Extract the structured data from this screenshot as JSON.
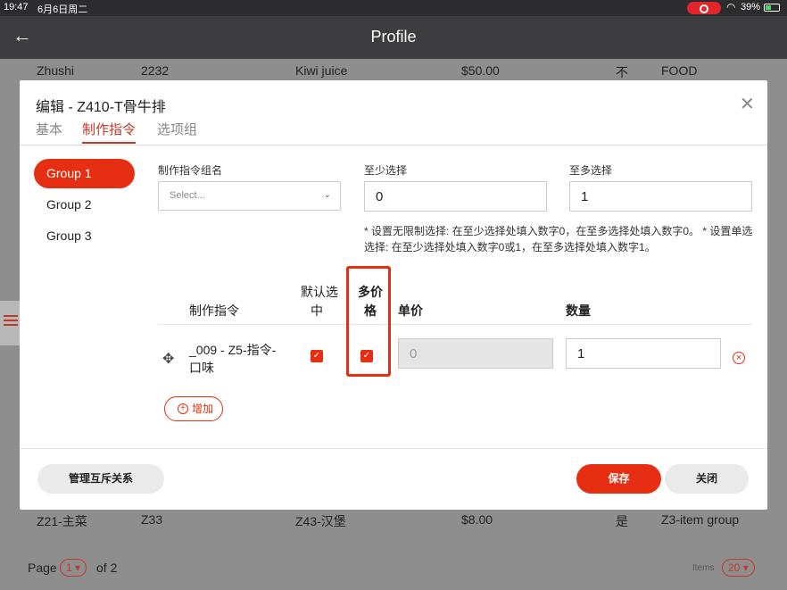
{
  "status_bar": {
    "time": "19:47",
    "date": "6月6日周二",
    "battery": "39%"
  },
  "header": {
    "back_icon": "arrow-left-icon",
    "title": "Profile"
  },
  "background_rows": [
    {
      "c1": "Zhushi",
      "c2": "2232",
      "c3": "Kiwi juice",
      "c4": "$50.00",
      "c5": "不",
      "c6": "FOOD"
    },
    {
      "c1": "Z21-主菜",
      "c2": "Z33",
      "c3": "Z43-汉堡",
      "c4": "$8.00",
      "c5": "是",
      "c6": "Z3-item group"
    }
  ],
  "pagination": {
    "page_label": "Page",
    "page_value": "1",
    "of_label": "of 2",
    "items_label": "Items",
    "items_value": "20"
  },
  "modal": {
    "title": "编辑 - Z410-T骨牛排",
    "tabs": [
      "基本",
      "制作指令",
      "选项组"
    ],
    "groups": [
      "Group 1",
      "Group 2",
      "Group 3"
    ],
    "fields": {
      "group_name_label": "制作指令组名",
      "select_placeholder": "Select...",
      "min_label": "至少选择",
      "min_value": "0",
      "max_label": "至多选择",
      "max_value": "1"
    },
    "note": "* 设置无限制选择: 在至少选择处填入数字0，在至多选择处填入数字0。 * 设置单选选择: 在至少选择处填入数字0或1，在至多选择处填入数字1。",
    "table_headers": {
      "instruction": "制作指令",
      "default_selected_1": "默认选",
      "default_selected_2": "中",
      "multi_price_1": "多价",
      "multi_price_2": "格",
      "unit_price": "单价",
      "quantity": "数量"
    },
    "row": {
      "name_1": "_009 - Z5-指令-",
      "name_2": "口味",
      "default_checked": true,
      "multi_price_checked": true,
      "unit_price": "0",
      "quantity": "1"
    },
    "add_label": "增加",
    "manage_button": "管理互斥关系",
    "save_button": "保存",
    "close_button": "关闭"
  },
  "colors": {
    "accent": "#e62e12",
    "header": "#3d3d3f"
  }
}
